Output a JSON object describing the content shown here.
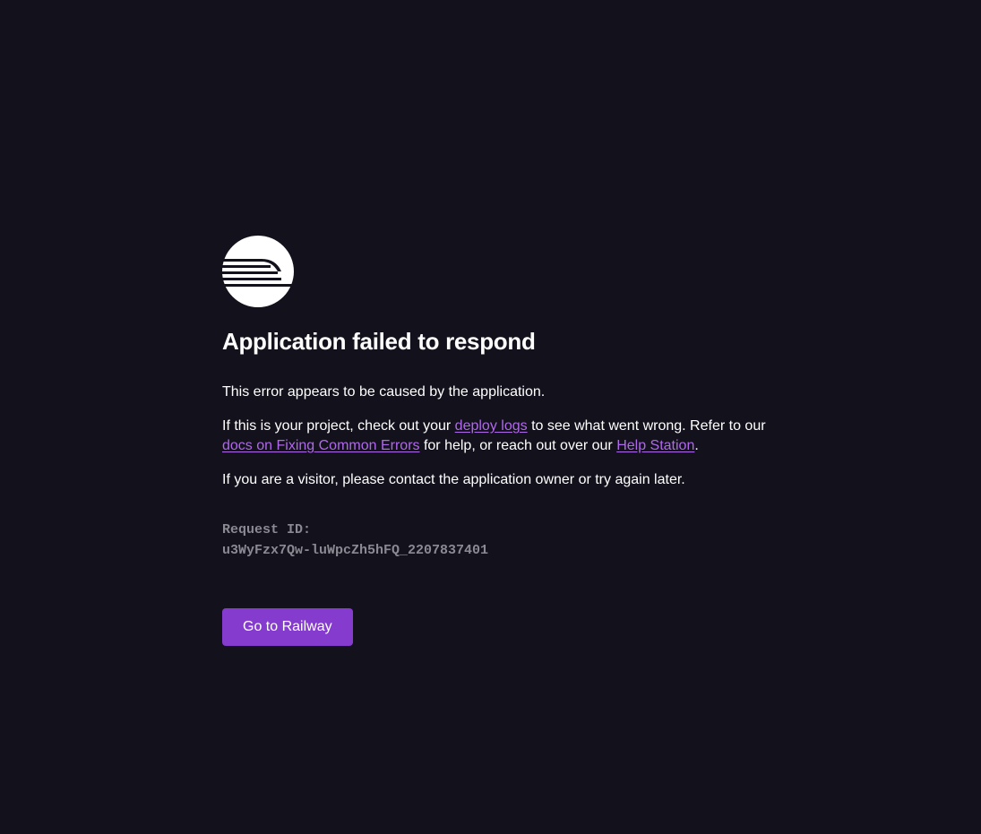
{
  "logo": {
    "icon": "railway-logo-icon"
  },
  "title": "Application failed to respond",
  "paragraph1": "This error appears to be caused by the application.",
  "paragraph2": {
    "text1": "If this is your project, check out your ",
    "link1": "deploy logs",
    "text2": " to see what went wrong. Refer to our ",
    "link2": "docs on Fixing Common Errors",
    "text3": " for help, or reach out over our ",
    "link3": "Help Station",
    "text4": "."
  },
  "paragraph3": "If you are a visitor, please contact the application owner or try again later.",
  "request": {
    "label": "Request ID:",
    "id": "u3WyFzx7Qw-luWpcZh5hFQ_2207837401"
  },
  "button": {
    "label": "Go to Railway"
  },
  "colors": {
    "background": "#13111c",
    "link": "#b068ec",
    "button": "#853bce",
    "muted": "#8b8a93"
  }
}
